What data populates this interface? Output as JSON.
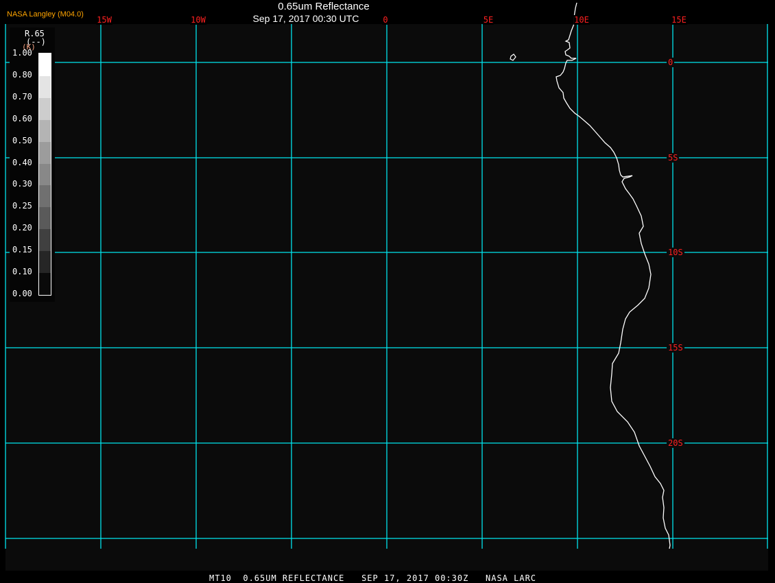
{
  "header": {
    "title": "0.65um Reflectance",
    "subtitle": "Sep 17, 2017 00:30 UTC",
    "credit": "NASA Langley (M04.0)"
  },
  "lon_labels": [
    "15W",
    "10W",
    "0",
    "5E",
    "10E",
    "15E"
  ],
  "lat_labels": [
    "0",
    "5S",
    "10S",
    "15S",
    "20S"
  ],
  "legend": {
    "variable": "R.65",
    "units": "(--)",
    "units2": "(K)",
    "labels": [
      "1.00",
      "0.80",
      "0.70",
      "0.60",
      "0.50",
      "0.40",
      "0.30",
      "0.25",
      "0.20",
      "0.15",
      "0.10",
      "0.00"
    ],
    "colors": [
      "#ffffff",
      "#ffffff",
      "#e4e4e4",
      "#cdcdcd",
      "#b4b4b4",
      "#9c9c9c",
      "#888888",
      "#707070",
      "#5a5a5a",
      "#404040",
      "#262626",
      "#0a0a0a"
    ]
  },
  "footer": "MT10  0.65UM REFLECTANCE   SEP 17, 2017 00:30Z   NASA LARC",
  "colors": {
    "grid": "#00e5ee",
    "labels": "#ff2020",
    "coastline": "#ffffff",
    "credit": "#ffa500"
  }
}
